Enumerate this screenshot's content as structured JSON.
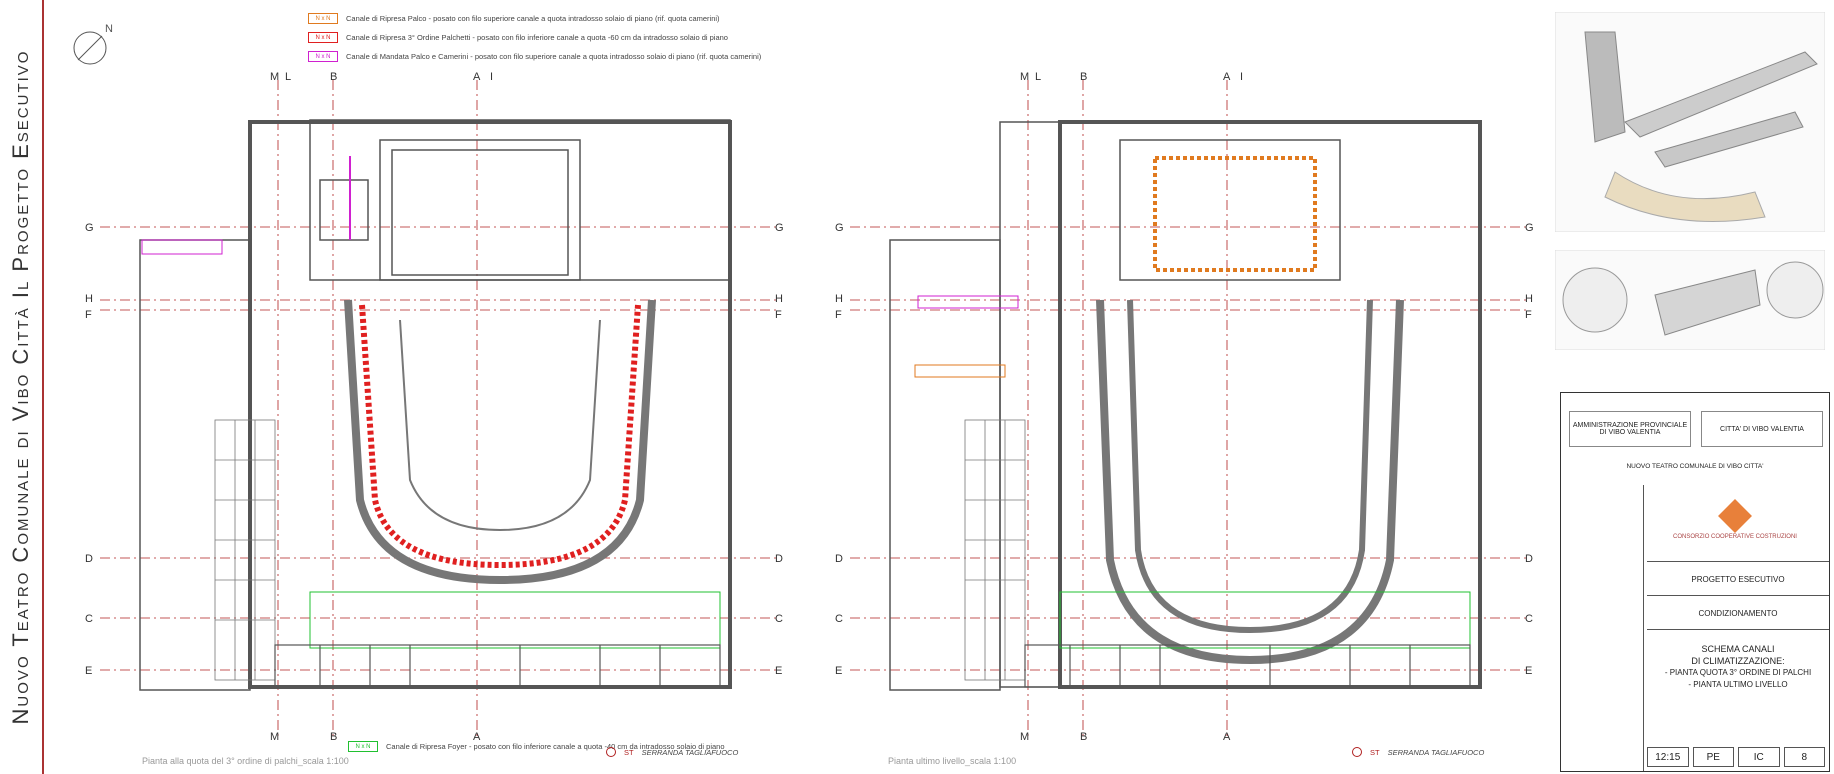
{
  "vertical_title": "Nuovo Teatro Comunale di Vibo Città   Il Progetto Esecutivo",
  "legend": [
    {
      "tag": "N x N",
      "text": "Canale di Ripresa Palco - posato con filo superiore canale a quota intradosso  solaio di piano (rif. quota camerini)",
      "color": "#e07a1f"
    },
    {
      "tag": "N x N",
      "text": "Canale di Ripresa 3° Ordine Palchetti - posato con filo inferiore canale a quota -60 cm da intradosso solaio di piano",
      "color": "#e02020"
    },
    {
      "tag": "N x N",
      "text": "Canale di Mandata Palco e Camerini - posato con filo superiore canale a quota intradosso solaio di piano (rif. quota camerini)",
      "color": "#d020d0"
    }
  ],
  "bottom_legend": {
    "tag": "N x N",
    "text": "Canale di Ripresa Foyer - posato con filo inferiore canale a quota -40 cm da intradosso solaio di piano",
    "color": "#20c030"
  },
  "serranda_label": "SERRANDA TAGLIAFUOCO",
  "serranda_code": "ST",
  "captions": {
    "left": "Pianta alla quota del 3° ordine di palchi_scala 1:100",
    "right": "Pianta ultimo livello_scala 1:100"
  },
  "axis_labels": {
    "top": [
      "M",
      "L",
      "B",
      "A",
      "I"
    ],
    "sides": [
      "G",
      "H",
      "F",
      "D",
      "C",
      "E"
    ]
  },
  "title_block": {
    "client_left": "AMMINISTRAZIONE PROVINCIALE DI VIBO VALENTIA",
    "client_right": "CITTA' DI VIBO VALENTIA",
    "project_desc": "NUOVO TEATRO COMUNALE DI VIBO CITTA'",
    "contractor": "CONSORZIO COOPERATIVE COSTRUZIONI",
    "phase": "PROGETTO ESECUTIVO",
    "discipline": "CONDIZIONAMENTO",
    "title_lines": [
      "SCHEMA CANALI",
      "DI CLIMATIZZAZIONE:",
      "- PIANTA QUOTA 3° ORDINE DI PALCHI",
      "- PIANTA ULTIMO LIVELLO"
    ],
    "codes": [
      "12:15",
      "PE",
      "IC",
      "8"
    ]
  },
  "colors": {
    "wall": "#555555",
    "orange": "#e07a1f",
    "red": "#e02020",
    "magenta": "#d020d0",
    "green": "#20c030",
    "cyan": "#20c0e0",
    "axis": "#b02020"
  }
}
